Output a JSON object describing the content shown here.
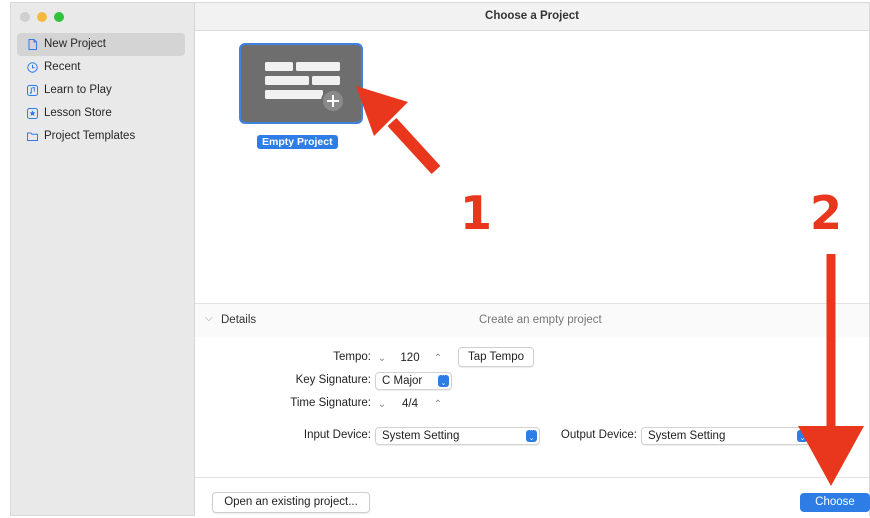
{
  "window": {
    "title": "Choose a Project"
  },
  "sidebar": {
    "items": [
      {
        "label": "New Project",
        "icon": "document-icon",
        "selected": true
      },
      {
        "label": "Recent",
        "icon": "clock-icon",
        "selected": false
      },
      {
        "label": "Learn to Play",
        "icon": "music-note-icon",
        "selected": false
      },
      {
        "label": "Lesson Store",
        "icon": "star-icon",
        "selected": false
      },
      {
        "label": "Project Templates",
        "icon": "folder-icon",
        "selected": false
      }
    ]
  },
  "project_tile": {
    "label": "Empty Project",
    "icon": "empty-project-icon"
  },
  "details": {
    "label": "Details",
    "description": "Create an empty project",
    "tempo": {
      "label": "Tempo:",
      "value": "120"
    },
    "tap_tempo": "Tap Tempo",
    "key_signature": {
      "label": "Key Signature:",
      "value": "C Major"
    },
    "time_signature": {
      "label": "Time Signature:",
      "value": "4/4"
    },
    "input_device": {
      "label": "Input Device:",
      "value": "System Setting"
    },
    "output_device": {
      "label": "Output Device:",
      "value": "System Setting"
    }
  },
  "footer": {
    "open_existing": "Open an existing project...",
    "choose": "Choose"
  },
  "annotations": {
    "step1": "1",
    "step2": "2",
    "color": "#e8371c"
  },
  "colors": {
    "accent": "#2e7ce6",
    "sidebar_bg": "#e9e9e9",
    "tile_bg": "#6e6e6e"
  }
}
